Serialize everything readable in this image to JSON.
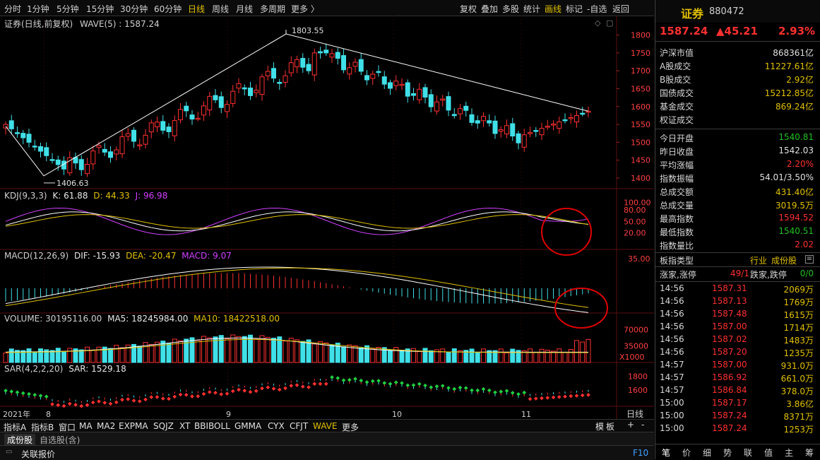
{
  "toolbar": {
    "periods": [
      "分时",
      "1分钟",
      "5分钟",
      "15分钟",
      "30分钟",
      "60分钟",
      "日线",
      "周线",
      "月线",
      "多周期",
      "更多 〉"
    ],
    "active_period": "日线",
    "tools": [
      "复权",
      "叠加",
      "多股",
      "统计",
      "画线",
      "标记",
      "-自选",
      "返回"
    ],
    "active_tool": "画线"
  },
  "main_chart": {
    "title": "证券(日线,前复权)",
    "indicator": "WAVE(5) : 1587.24",
    "high_label": "1803.55",
    "low_label": "1406.63",
    "y_ticks": [
      "1800",
      "1750",
      "1700",
      "1650",
      "1600",
      "1550",
      "1500",
      "1450",
      "1400"
    ]
  },
  "kdj": {
    "name": "KDJ(9,3,3)",
    "k": "K: 61.88",
    "d": "D: 44.33",
    "j": "J: 96.98",
    "ticks": [
      "100.00",
      "80.00",
      "50.00",
      "20.00"
    ]
  },
  "macd": {
    "name": "MACD(12,26,9)",
    "dif": "DIF: -15.93",
    "dea": "DEA: -20.47",
    "macd": "MACD: 9.07",
    "ticks": [
      "35.00"
    ]
  },
  "volume": {
    "name": "VOLUME: 30195116.00",
    "ma5": "MA5: 18245984.00",
    "ma10": "MA10: 18422518.00",
    "ticks": [
      "70000",
      "35000"
    ],
    "unit": "X1000"
  },
  "sar": {
    "name": "SAR(4,2,2,20)",
    "value": "SAR: 1529.18",
    "ticks": [
      "1800",
      "1600"
    ]
  },
  "x_axis": {
    "labels": [
      "2021年",
      "8",
      "9",
      "10",
      "11"
    ],
    "period": "日线"
  },
  "bottom_tabs": [
    "指标A",
    "指标B",
    "窗口",
    "MA",
    "MA2",
    "EXPMA",
    "SQJZ",
    "XT",
    "BBIBOLL",
    "GMMA",
    "CYX",
    "CFJT",
    "WAVE",
    "更多"
  ],
  "bottom_right": {
    "mode": "模",
    "board": "板",
    "plus": "+",
    "minus": "-"
  },
  "status_bar": {
    "tabs": [
      "成份股",
      "自选股(含)"
    ],
    "quote_link": "关联报价",
    "f10": "F10"
  },
  "stock": {
    "name": "证券",
    "code": "880472",
    "price": "1587.24",
    "change": "▲45.21",
    "pct": "2.93%"
  },
  "market": [
    {
      "label": "沪深市值",
      "value": "868361亿",
      "color": "#e0e0e0"
    },
    {
      "label": "A股成交",
      "value": "11227.61亿",
      "color": "#e0c000"
    },
    {
      "label": "B股成交",
      "value": "2.92亿",
      "color": "#e0c000"
    },
    {
      "label": "国债成交",
      "value": "15212.85亿",
      "color": "#e0c000"
    },
    {
      "label": "基金成交",
      "value": "869.24亿",
      "color": "#e0c000"
    },
    {
      "label": "权证成交",
      "value": "",
      "color": "#e0c000"
    }
  ],
  "stats": [
    {
      "label": "今日开盘",
      "value": "1540.81",
      "color": "#20c020"
    },
    {
      "label": "昨日收盘",
      "value": "1542.03",
      "color": "#e0e0e0"
    },
    {
      "label": "平均涨幅",
      "value": "2.20%",
      "color": "#ff3030"
    },
    {
      "label": "指数振幅",
      "value": "54.01/3.50%",
      "color": "#e0e0e0"
    },
    {
      "label": "总成交额",
      "value": "431.40亿",
      "color": "#e0c000"
    },
    {
      "label": "总成交量",
      "value": "3019.5万",
      "color": "#e0c000"
    },
    {
      "label": "最高指数",
      "value": "1594.52",
      "color": "#ff3030"
    },
    {
      "label": "最低指数",
      "value": "1540.51",
      "color": "#20c020"
    },
    {
      "label": "指数量比",
      "value": "2.02",
      "color": "#ff3030"
    }
  ],
  "board": {
    "label": "板指类型",
    "type": "行业",
    "link": "成份股"
  },
  "updown": {
    "up_label": "涨家,涨停",
    "up_value": "49/1",
    "down_label": "跌家,跌停",
    "down_value": "0/0"
  },
  "ticks": [
    {
      "time": "14:56",
      "price": "1587.31",
      "vol": "2069万"
    },
    {
      "time": "14:56",
      "price": "1587.13",
      "vol": "1769万"
    },
    {
      "time": "14:56",
      "price": "1587.48",
      "vol": "1615万"
    },
    {
      "time": "14:56",
      "price": "1587.00",
      "vol": "1714万"
    },
    {
      "time": "14:56",
      "price": "1587.02",
      "vol": "1483万"
    },
    {
      "time": "14:56",
      "price": "1587.20",
      "vol": "1235万"
    },
    {
      "time": "14:57",
      "price": "1587.00",
      "vol": "931.0万"
    },
    {
      "time": "14:57",
      "price": "1586.92",
      "vol": "661.0万"
    },
    {
      "time": "14:57",
      "price": "1586.84",
      "vol": "378.0万"
    },
    {
      "time": "15:00",
      "price": "1587.17",
      "vol": "3.86亿"
    },
    {
      "time": "15:00",
      "price": "1587.24",
      "vol": "8371万"
    },
    {
      "time": "15:00",
      "price": "1587.24",
      "vol": "1253万"
    }
  ],
  "right_tabs": [
    "笔",
    "价",
    "细",
    "势",
    "联",
    "值",
    "主",
    "筹"
  ],
  "colors": {
    "up": "#ff3030",
    "down": "#40e0e8",
    "accent": "#e0c000",
    "circle": "#e00000"
  }
}
